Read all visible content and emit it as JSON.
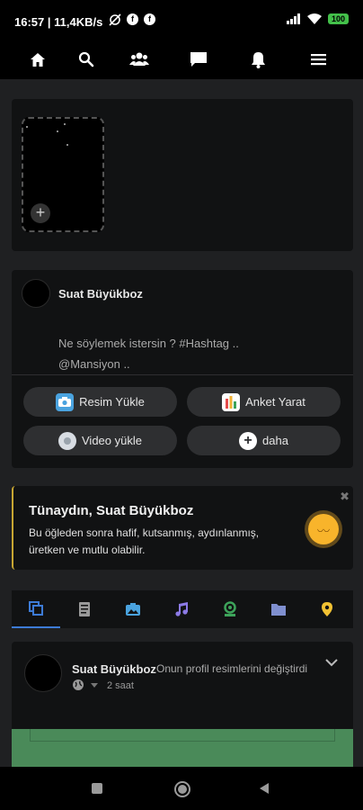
{
  "status_bar": {
    "time": "16:57",
    "speed": "11,4KB/s",
    "battery": "100"
  },
  "top_nav": {
    "icons": [
      "home-icon",
      "search-icon",
      "friends-icon",
      "messages-icon",
      "notifications-icon",
      "menu-icon"
    ]
  },
  "stories": {
    "add_symbol": "+"
  },
  "composer": {
    "user_name": "Suat Büyükboz",
    "placeholder_line1": "Ne söylemek istersin ? #Hashtag ..",
    "placeholder_line2": "@Mansiyon ..",
    "buttons": {
      "upload_image": "Resim Yükle",
      "create_poll": "Anket Yarat",
      "upload_video": "Video yükle",
      "more": "daha"
    }
  },
  "greeting": {
    "title": "Tünaydın, Suat Büyükboz",
    "body": "Bu öğleden sonra hafif, kutsanmış, aydınlanmış, üretken ve mutlu olabilir.",
    "close": "✖"
  },
  "feed_tabs": [
    "all-posts",
    "text",
    "photos",
    "music",
    "video",
    "files",
    "places"
  ],
  "post": {
    "user_name": "Suat Büyükboz",
    "action": "Onun profil resimlerini değiştirdi",
    "time": "2 saat"
  },
  "colors": {
    "accent": "#3d7bd6",
    "greeting_border": "#c8a632",
    "sun": "#f8b42b"
  }
}
